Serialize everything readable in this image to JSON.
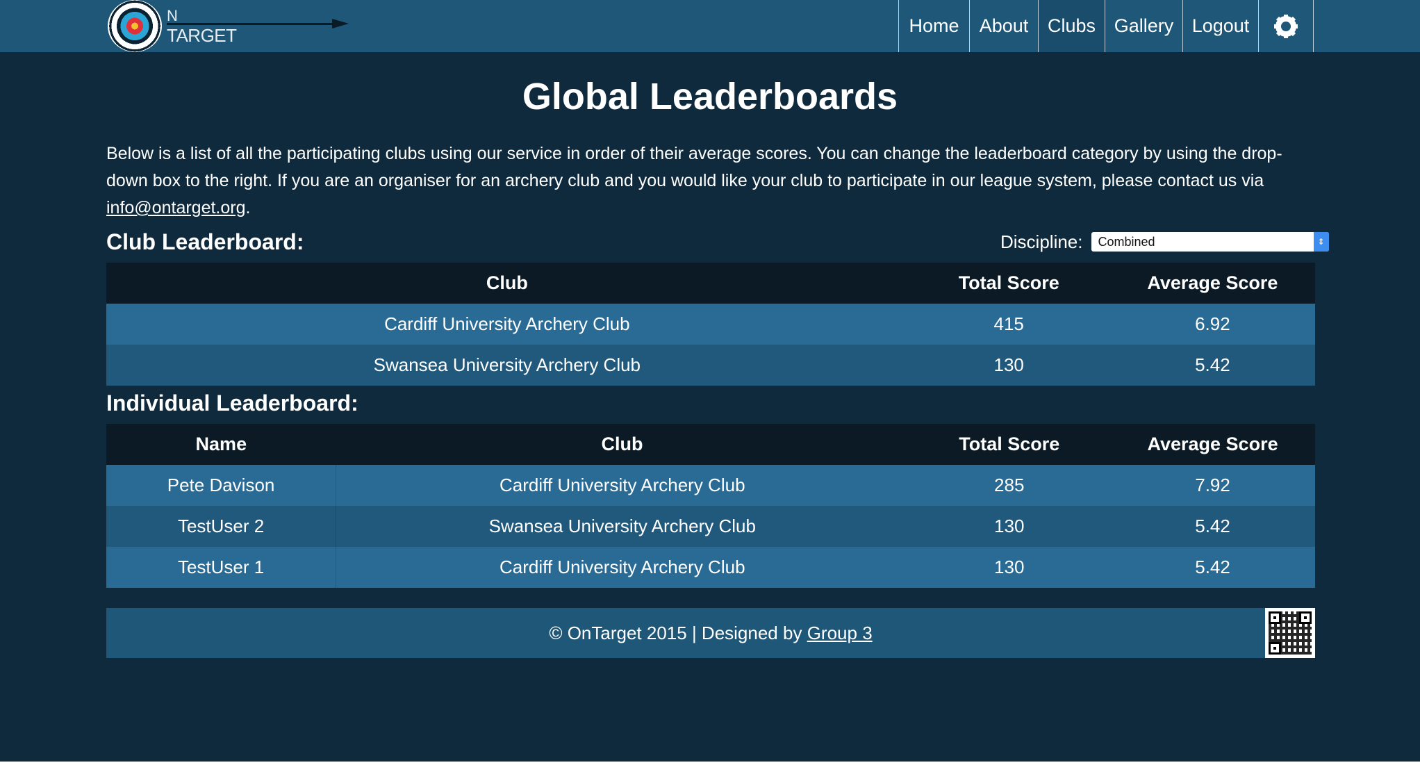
{
  "brand": {
    "logo_text_top": "N",
    "logo_text_bottom": "TARGET"
  },
  "nav": {
    "items": [
      {
        "label": "Home"
      },
      {
        "label": "About"
      },
      {
        "label": "Clubs"
      },
      {
        "label": "Gallery"
      },
      {
        "label": "Logout"
      }
    ],
    "active": "Clubs"
  },
  "page": {
    "title": "Global Leaderboards",
    "intro_text": "Below is a list of all the participating clubs using our service in order of their average scores. You can change the leaderboard category by using the drop-down box to the right. If you are an organiser for an archery club and you would like your club to participate in our league system, please contact us via ",
    "intro_link": "info@ontarget.org",
    "intro_end": "."
  },
  "club_leaderboard": {
    "heading": "Club Leaderboard:",
    "discipline_label": "Discipline:",
    "discipline_value": "Combined",
    "columns": [
      "Club",
      "Total Score",
      "Average Score"
    ],
    "rows": [
      {
        "club": "Cardiff University Archery Club",
        "total": "415",
        "average": "6.92"
      },
      {
        "club": "Swansea University Archery Club",
        "total": "130",
        "average": "5.42"
      }
    ]
  },
  "individual_leaderboard": {
    "heading": "Individual Leaderboard:",
    "columns": [
      "Name",
      "Club",
      "Total Score",
      "Average Score"
    ],
    "rows": [
      {
        "name": "Pete Davison",
        "club": "Cardiff University Archery Club",
        "total": "285",
        "average": "7.92"
      },
      {
        "name": "TestUser 2",
        "club": "Swansea University Archery Club",
        "total": "130",
        "average": "5.42"
      },
      {
        "name": "TestUser 1",
        "club": "Cardiff University Archery Club",
        "total": "130",
        "average": "5.42"
      }
    ]
  },
  "footer": {
    "text": "© OnTarget 2015 | Designed by ",
    "link": "Group 3"
  },
  "colors": {
    "background": "#0f2a3d",
    "navbar": "#1f5778",
    "table_header": "#0b1a25",
    "row_odd": "#296b94",
    "row_even": "#21597d"
  }
}
